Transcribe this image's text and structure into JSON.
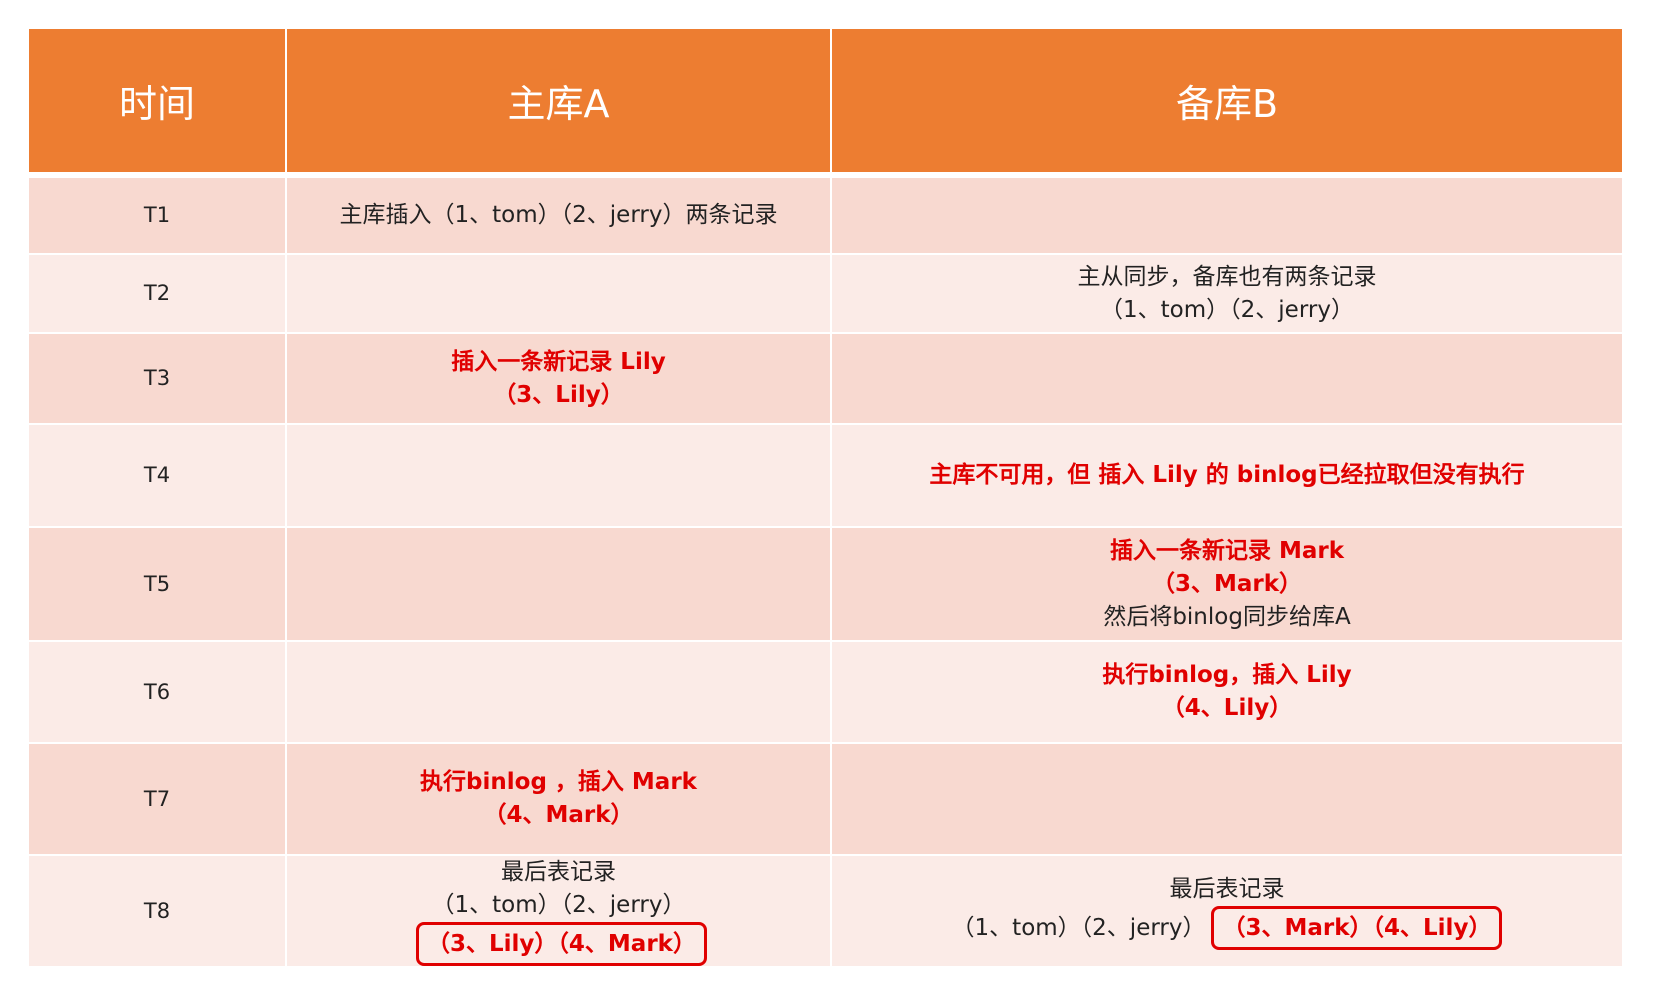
{
  "headers": [
    "时间",
    "主库A",
    "备库B"
  ],
  "rows": [
    {
      "time": "T1",
      "a": [
        "主库插入（1、tom）（2、jerry）两条记录"
      ],
      "b": []
    },
    {
      "time": "T2",
      "a": [],
      "b": [
        "主从同步，备库也有两条记录",
        "（1、tom）（2、jerry）"
      ]
    },
    {
      "time": "T3",
      "a": [
        "插入一条新记录 Lily",
        "（3、Lily）"
      ],
      "b": []
    },
    {
      "time": "T4",
      "a": [],
      "b": [
        "主库不可用，但 插入 Lily 的 binlog已经拉取但没有执行"
      ]
    },
    {
      "time": "T5",
      "a": [],
      "b": [
        "插入一条新记录 Mark",
        "（3、Mark）",
        "然后将binlog同步给库A"
      ]
    },
    {
      "time": "T6",
      "a": [],
      "b": [
        "执行binlog，插入 Lily",
        "（4、Lily）"
      ]
    },
    {
      "time": "T7",
      "a": [
        "执行binlog ，插入 Mark",
        "（4、Mark）"
      ],
      "b": []
    },
    {
      "time": "T8",
      "a": {
        "title": "最后表记录",
        "prefix": "（1、tom）（2、jerry）",
        "boxed": "（3、Lily）（4、Mark）"
      },
      "b": {
        "title": "最后表记录",
        "prefix": "（1、tom）（2、jerry）",
        "boxed": "（3、Mark）（4、Lily）"
      }
    }
  ],
  "colors": {
    "header_bg": "#ed7d31",
    "row_odd": "#f8d9d0",
    "row_even": "#fbebe7",
    "highlight_red": "#e00000"
  }
}
